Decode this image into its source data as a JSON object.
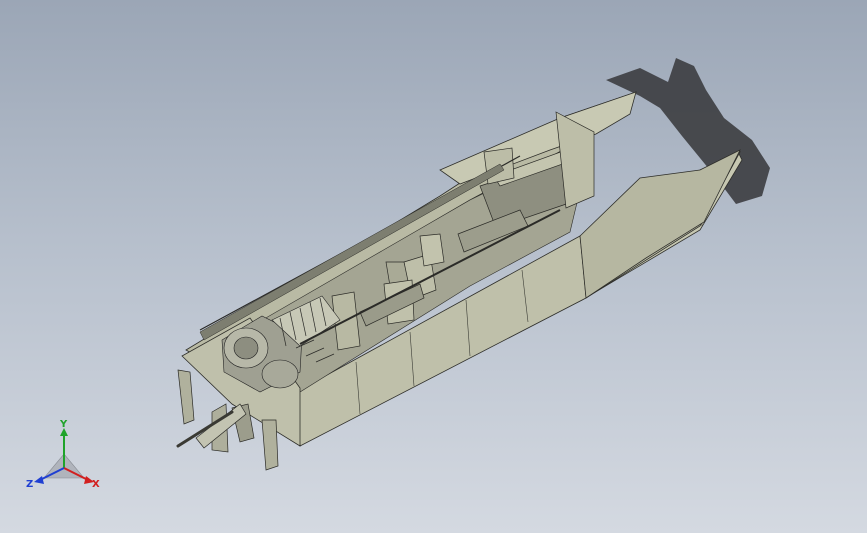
{
  "viewport": {
    "model": "catamaran-powerboat-assembly"
  },
  "triad": {
    "x_label": "X",
    "y_label": "Y",
    "z_label": "Z",
    "colors": {
      "x": "#d21f1f",
      "y": "#1fa32a",
      "z": "#1f3fd2"
    }
  },
  "colors": {
    "hull_light": "#c9cab4",
    "hull_mid": "#b4b59f",
    "hull_dark": "#8f9080",
    "edge": "#2e2e2a",
    "shadow": "#3f4042"
  }
}
